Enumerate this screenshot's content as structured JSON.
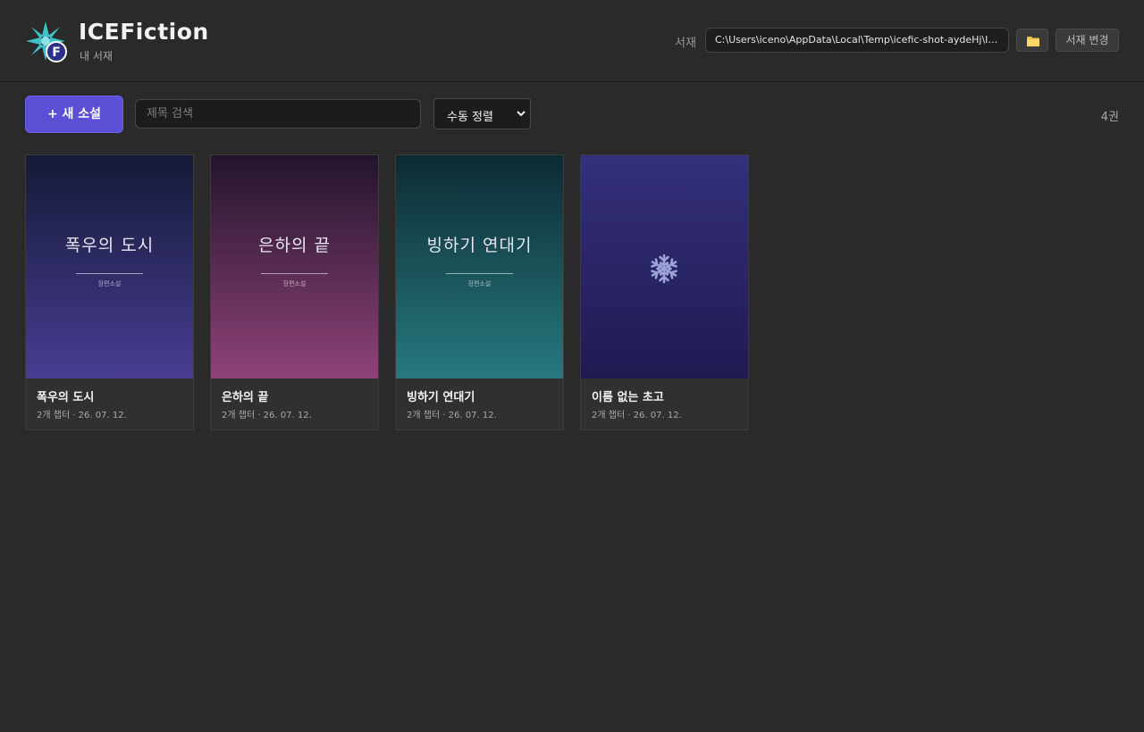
{
  "app": {
    "title": "ICEFiction",
    "subtitle": "내 서재"
  },
  "library": {
    "label": "서재",
    "path": "C:\\Users\\iceno\\AppData\\Local\\Temp\\icefic-shot-aydeHj\\IC...",
    "folder_icon": "folder-icon",
    "change_label": "서재 변경"
  },
  "toolbar": {
    "new_label": "+ 새 소설",
    "search_placeholder": "제목 검색",
    "search_value": "",
    "sort_selected": "수동 정렬",
    "count": "4권"
  },
  "colors": {
    "accent": "#5b4fd6",
    "background": "#2a2a2a",
    "card": "#303030",
    "folder": "#f5c242"
  },
  "books": [
    {
      "title": "폭우의 도시",
      "cover_title": "폭우의 도시",
      "cover_genre": "장편소설",
      "meta": "2개 챕터 · 26. 07. 12.",
      "gradient": [
        "#141a37",
        "#483d93"
      ]
    },
    {
      "title": "은하의 끝",
      "cover_title": "은하의 끝",
      "cover_genre": "장편소설",
      "meta": "2개 챕터 · 26. 07. 12.",
      "gradient": [
        "#22142b",
        "#8f4379"
      ]
    },
    {
      "title": "빙하기 연대기",
      "cover_title": "빙하기 연대기",
      "cover_genre": "장편소설",
      "meta": "2개 챕터 · 26. 07. 12.",
      "gradient": [
        "#0d2a33",
        "#27797f"
      ]
    },
    {
      "title": "이름 없는 초고",
      "cover_icon": "snowflake-icon",
      "meta": "2개 챕터 · 26. 07. 12.",
      "gradient": [
        "#34307a",
        "#201a52"
      ]
    }
  ]
}
